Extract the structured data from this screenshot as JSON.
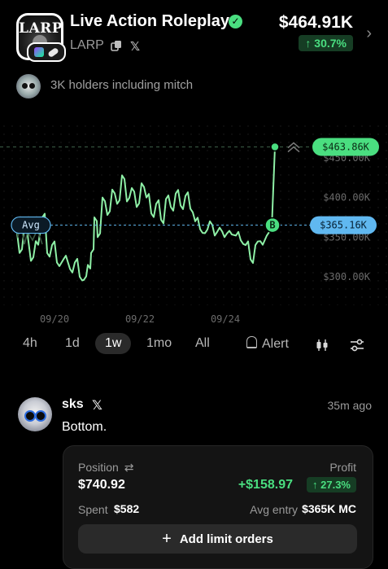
{
  "token": {
    "logo_text": "LARP",
    "name": "Live Action Roleplay",
    "ticker": "LARP",
    "price": "$464.91K",
    "change": "↑ 30.7%",
    "holders_text": "3K holders including mitch"
  },
  "chart": {
    "y_ticks": [
      "$450.00K",
      "$400.00K",
      "$350.00K",
      "$300.00K"
    ],
    "x_ticks": [
      "09/20",
      "09/22",
      "09/24"
    ],
    "current_label": "$463.86K",
    "avg_label": "Avg",
    "avg_value_label": "$365.16K",
    "buy_marker": "B",
    "colors": {
      "line": "#8ef0a6",
      "current": "#4ade80",
      "avg": "#60b8f0"
    }
  },
  "chart_data": {
    "type": "line",
    "ylim": [
      280,
      470
    ],
    "yunit": "$K",
    "current_value": 463.86,
    "avg_value": 365.16,
    "x": [
      "09/19",
      "09/20",
      "09/21",
      "09/22",
      "09/23",
      "09/24",
      "09/25"
    ],
    "values": [
      360,
      335,
      295,
      420,
      375,
      360,
      328,
      350,
      463.86
    ],
    "series_note": ""
  },
  "timeframes": {
    "items": [
      "4h",
      "1d",
      "1w",
      "1mo",
      "All"
    ],
    "active": "1w",
    "alert_label": "Alert"
  },
  "post": {
    "user": "sks",
    "time": "35m ago",
    "text": "Bottom.",
    "position_label": "Position",
    "position_value": "$740.92",
    "profit_label": "Profit",
    "profit_value": "+$158.97",
    "profit_pct": "↑ 27.3%",
    "spent_label": "Spent",
    "spent_value": "$582",
    "avg_entry_label": "Avg entry",
    "avg_entry_value": "$365K MC",
    "limit_button": "Add limit orders"
  }
}
